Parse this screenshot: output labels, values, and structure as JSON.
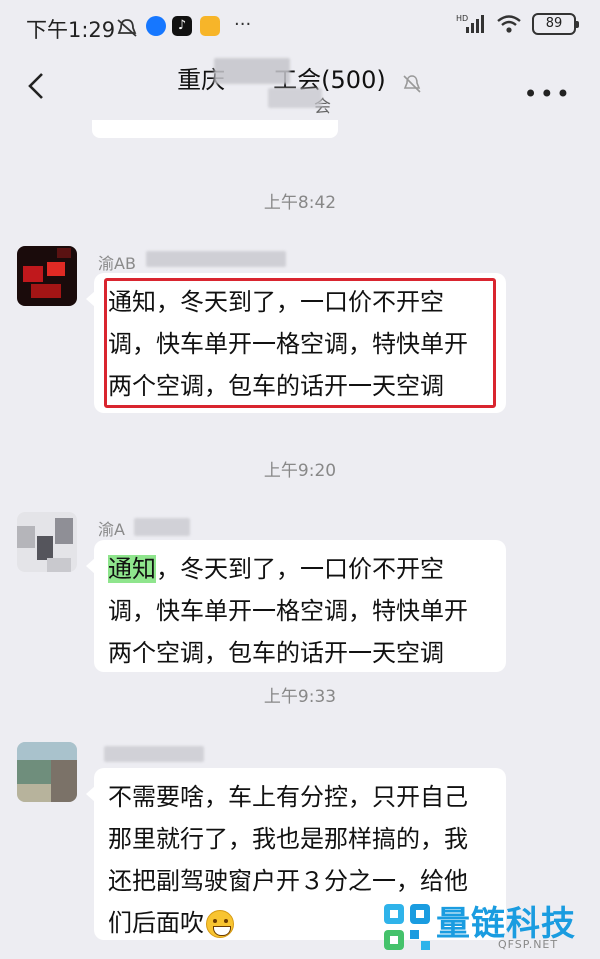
{
  "status_bar": {
    "time": "下午1:29",
    "battery": "89",
    "network": "HD"
  },
  "header": {
    "title": "重庆　　工会(500)",
    "subtitle": "会"
  },
  "messages": [
    {
      "timestamp": "上午8:42",
      "sender": "渝AB",
      "text_lines": [
        "通知，冬天到了，一口价不开空",
        "调，快车单开一格空调，特快单开",
        "两个空调，包车的话开一天空调"
      ]
    },
    {
      "timestamp": "上午9:20",
      "sender": "渝A",
      "highlight": "通知",
      "text_lines": [
        "，冬天到了，一口价不开空",
        "调，快车单开一格空调，特快单开",
        "两个空调，包车的话开一天空调"
      ]
    },
    {
      "timestamp": "上午9:33",
      "sender": "",
      "text_lines": [
        "不需要啥，车上有分控，只开自己",
        "那里就行了，我也是那样搞的，我",
        "还把副驾驶窗户开３分之一，给他",
        "们后面吹"
      ]
    }
  ],
  "watermark": {
    "text": "量链科技",
    "domain": "QFSP.NET",
    "color": "#1a9ce0"
  },
  "colors": {
    "background": "#ededf2",
    "highlight_box": "#d9252f",
    "keyword_highlight": "#8fe58d"
  }
}
